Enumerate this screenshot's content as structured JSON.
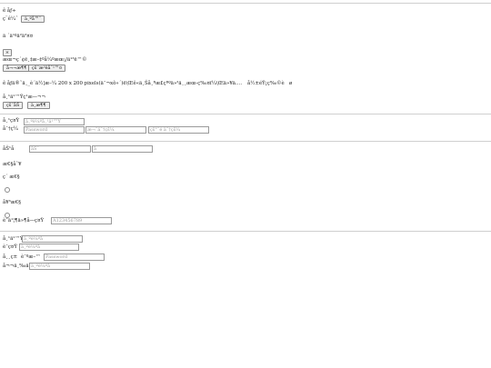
{
  "header": {
    "title": "ê åƒ÷",
    "choose_label": "ç¨ê¼ˆ",
    "choose_button": "ä¸ºå™¨"
  },
  "captcha": {
    "image_alt": "ä  ´ä¹ºä²ä²¤¤"
  },
  "drop": {
    "close_button": "×",
    "notice": "æœ¬ç´¢ë¸‡æ–‡ºå¼ºæœ¡/ä¹³ë™©",
    "btn_a": "å¬¬æ¶¶",
    "btn_b": "çš¨æ³ëå¯¹™¤"
  },
  "size_note": {
    "text": "ê åƒä®˜ä¸_è´ä½¦æ–¼ 200 x 200 pixels(ä¯¬xô»´)ë\\Œê«ä¸Šå¸ªæ£çªºä»²ä¸¸æœ-ç‰¤ï¼\\Œä»¥ä….",
    "aside": "å½±éŸ¡ç‰©è",
    "mark": "ø"
  },
  "preview": {
    "label": "å¸¹ä¹™Ÿç¹æ—¬¬",
    "button": "çš¨åŠ",
    "button2": "ä¸­æ¶¶"
  },
  "form1": {
    "username_label": "å¸¹ç¤Ÿ",
    "username_placeholder": "ä¸ºè¼ºå¸¹ä¹™Ÿ",
    "password_label": "å¯†ç¼",
    "password_placeholder": "Password",
    "confirm_placeholder": "æ¬¯ä¯†çš¼",
    "confirm2_placeholder": "çš°¯é ä¯†çš¼"
  },
  "form2": {
    "name_label": "åŠ¹å",
    "first_placeholder": "åŠ¨",
    "last_placeholder": "å",
    "gender_label": "æ€§åˆ¥",
    "gender_option": "ç´ æ€§",
    "gender_option2": "å¥³æ€§",
    "id_label": "è¯ä¹¦¶ä»¶å—ç¤Ÿ",
    "id_placeholder": "A123456789"
  },
  "form3": {
    "row1_label": "å¸¹ä¹™Ÿ",
    "row1_placeholder": "ä¸ºè¼ºå",
    "row2_label": "è¯ç¤Ÿ",
    "row2_placeholder": "ä¸ºè¼ºå",
    "row3_label": "å¸¸ç±",
    "row3_label2": "è¯ºæ–™",
    "row3_placeholder": "Password",
    "row4_label": "å¬¬ä¸‰ä½",
    "row4_placeholder": "ä¸ºè¼ºå"
  }
}
